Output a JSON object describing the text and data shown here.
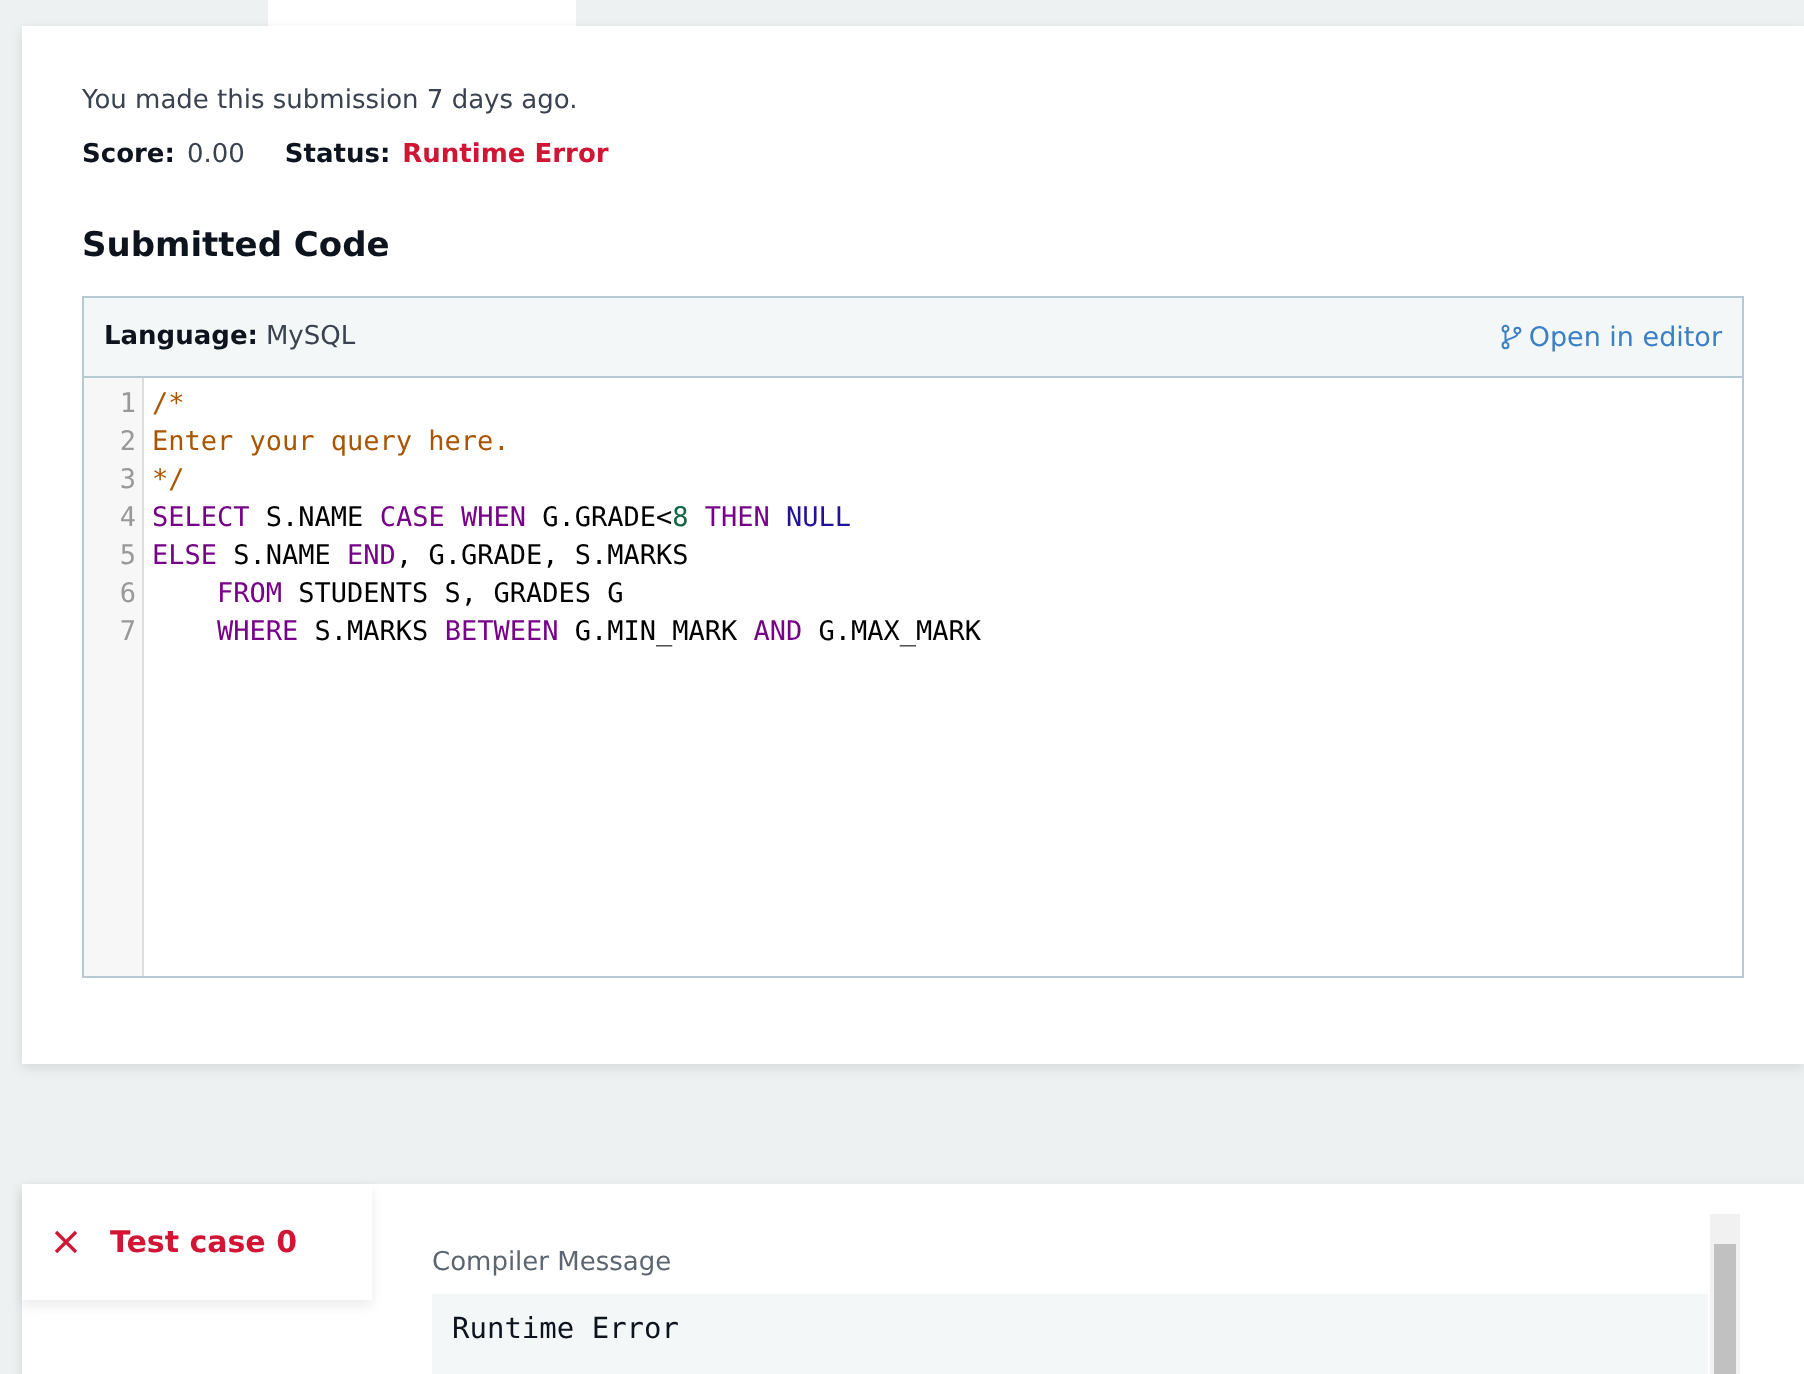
{
  "submission": {
    "made": "You made this submission 7 days ago.",
    "score_label": "Score:",
    "score": "0.00",
    "status_label": "Status:",
    "status": "Runtime Error"
  },
  "code_section": {
    "title": "Submitted Code",
    "language_label": "Language:",
    "language": "MySQL",
    "open_link": "Open in editor",
    "lines": [
      {
        "number": "1",
        "tokens": [
          {
            "text": "/*",
            "kind": "comment"
          }
        ]
      },
      {
        "number": "2",
        "tokens": [
          {
            "text": "Enter your query here.",
            "kind": "comment"
          }
        ]
      },
      {
        "number": "3",
        "tokens": [
          {
            "text": "*/",
            "kind": "comment"
          }
        ]
      },
      {
        "number": "4",
        "tokens": [
          {
            "text": "SELECT",
            "kind": "keyword"
          },
          {
            "text": " S.NAME ",
            "kind": "plain"
          },
          {
            "text": "CASE WHEN",
            "kind": "keyword"
          },
          {
            "text": " G.GRADE<",
            "kind": "plain"
          },
          {
            "text": "8",
            "kind": "number"
          },
          {
            "text": " THEN",
            "kind": "keyword"
          },
          {
            "text": " NULL",
            "kind": "atom"
          }
        ]
      },
      {
        "number": "5",
        "tokens": [
          {
            "text": "ELSE",
            "kind": "keyword"
          },
          {
            "text": " S.NAME ",
            "kind": "plain"
          },
          {
            "text": "END",
            "kind": "keyword"
          },
          {
            "text": ", G.GRADE, S.MARKS",
            "kind": "plain"
          }
        ]
      },
      {
        "number": "6",
        "tokens": [
          {
            "text": "    FROM",
            "kind": "keyword"
          },
          {
            "text": " STUDENTS S, GRADES G",
            "kind": "plain"
          }
        ]
      },
      {
        "number": "7",
        "tokens": [
          {
            "text": "    WHERE",
            "kind": "keyword"
          },
          {
            "text": " S.MARKS ",
            "kind": "plain"
          },
          {
            "text": "BETWEEN",
            "kind": "keyword"
          },
          {
            "text": " G.MIN_MARK ",
            "kind": "plain"
          },
          {
            "text": "AND",
            "kind": "keyword"
          },
          {
            "text": " G.MAX_MARK",
            "kind": "plain"
          }
        ]
      }
    ]
  },
  "test_cases": [
    {
      "label": "Test case 0",
      "kind": "failed",
      "selected": true
    }
  ],
  "compiler": {
    "label": "Compiler Message",
    "message": "Runtime Error"
  }
}
